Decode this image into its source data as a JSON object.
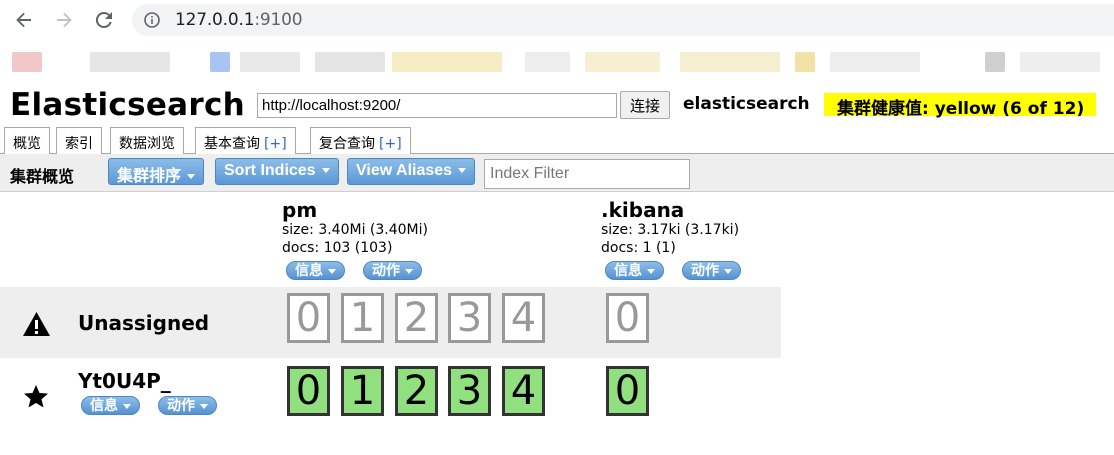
{
  "browser": {
    "url_host": "127.0.0.1",
    "url_port": ":9100"
  },
  "es": {
    "logo": "Elasticsearch",
    "connect_url": "http://localhost:9200/",
    "connect_label": "连接",
    "cluster_name": "elasticsearch",
    "health": "集群健康值: yellow (6 of 12)",
    "health_color": "#ffff00"
  },
  "tabs": [
    {
      "label": "概览"
    },
    {
      "label": "索引"
    },
    {
      "label": "数据浏览"
    },
    {
      "label": "基本查询",
      "plus": "[+]"
    },
    {
      "label": "复合查询",
      "plus": "[+]"
    }
  ],
  "toolbar": {
    "title": "集群概览",
    "sort_cluster": "集群排序",
    "sort_indices": "Sort Indices",
    "view_aliases": "View Aliases",
    "filter_placeholder": "Index Filter"
  },
  "indices": [
    {
      "name": "pm",
      "size": "size: 3.40Mi (3.40Mi)",
      "docs": "docs: 103 (103)",
      "info": "信息",
      "action": "动作"
    },
    {
      "name": ".kibana",
      "size": "size: 3.17ki (3.17ki)",
      "docs": "docs: 1 (1)",
      "info": "信息",
      "action": "动作"
    }
  ],
  "nodes": {
    "unassigned_label": "Unassigned",
    "node_name": "Yt0U4P_",
    "node_info": "信息",
    "node_action": "动作"
  },
  "shards": {
    "pm_unassigned": [
      "0",
      "1",
      "2",
      "3",
      "4"
    ],
    "kibana_unassigned": [
      "0"
    ],
    "pm_started": [
      "0",
      "1",
      "2",
      "3",
      "4"
    ],
    "kibana_started": [
      "0"
    ],
    "started_color": "#90e080"
  }
}
